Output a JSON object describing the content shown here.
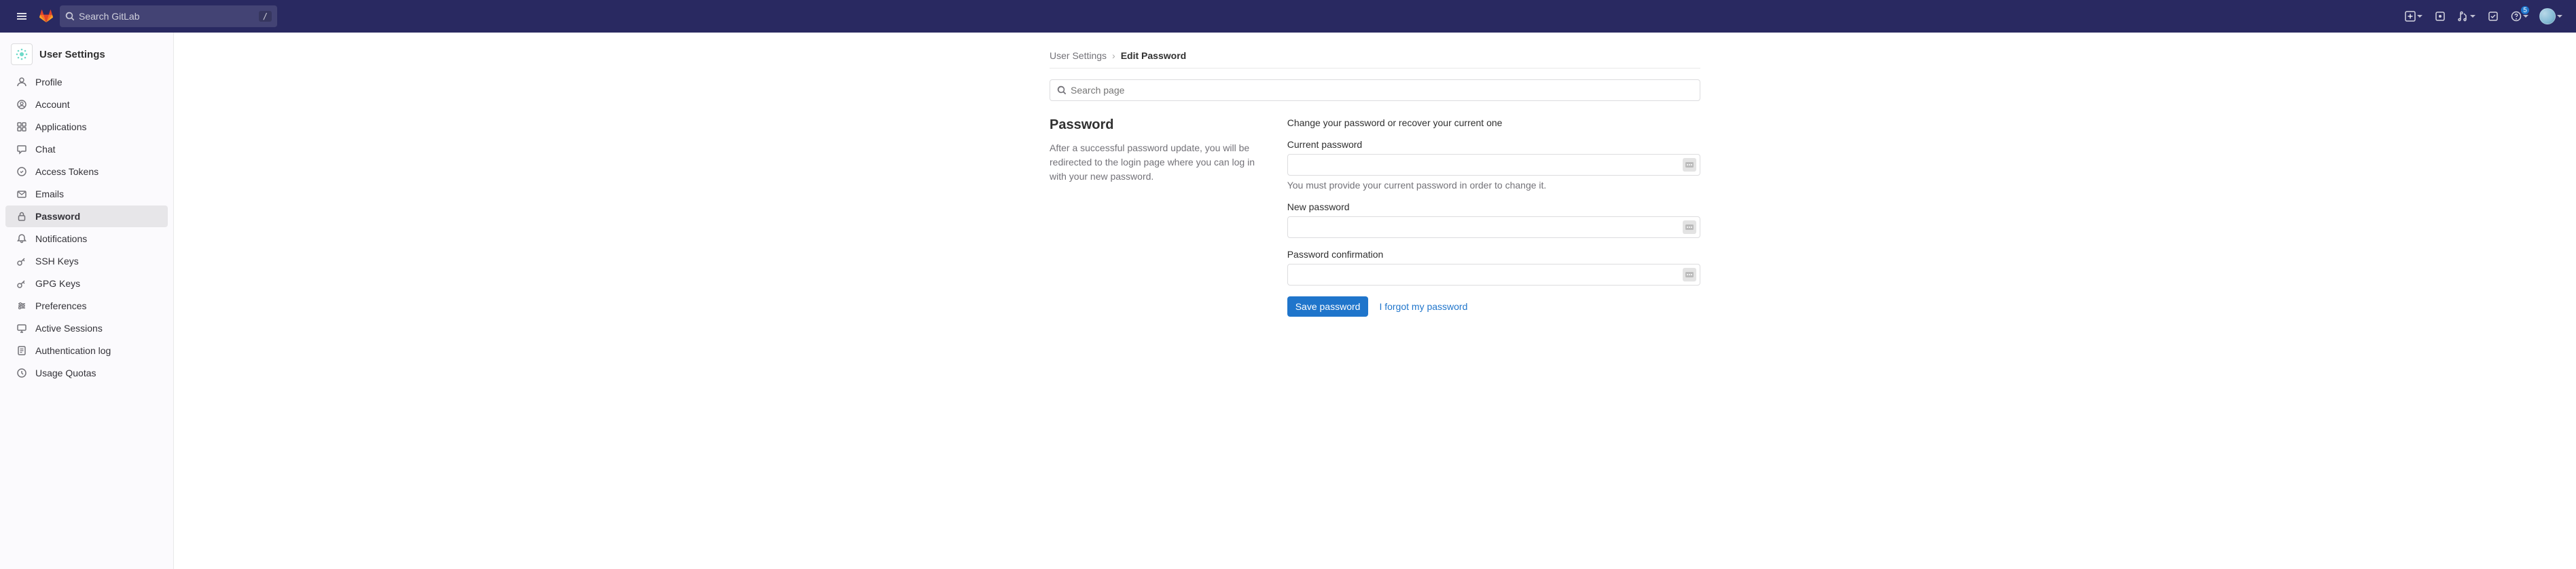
{
  "header": {
    "search_placeholder": "Search GitLab",
    "search_shortcut": "/",
    "issues_count": "5"
  },
  "sidebar": {
    "title": "User Settings",
    "items": [
      {
        "label": "Profile",
        "icon": "profile-icon"
      },
      {
        "label": "Account",
        "icon": "account-icon"
      },
      {
        "label": "Applications",
        "icon": "applications-icon"
      },
      {
        "label": "Chat",
        "icon": "chat-icon"
      },
      {
        "label": "Access Tokens",
        "icon": "token-icon"
      },
      {
        "label": "Emails",
        "icon": "email-icon"
      },
      {
        "label": "Password",
        "icon": "lock-icon",
        "active": true
      },
      {
        "label": "Notifications",
        "icon": "bell-icon"
      },
      {
        "label": "SSH Keys",
        "icon": "key-icon"
      },
      {
        "label": "GPG Keys",
        "icon": "key-icon"
      },
      {
        "label": "Preferences",
        "icon": "preferences-icon"
      },
      {
        "label": "Active Sessions",
        "icon": "sessions-icon"
      },
      {
        "label": "Authentication log",
        "icon": "log-icon"
      },
      {
        "label": "Usage Quotas",
        "icon": "quota-icon"
      }
    ]
  },
  "breadcrumb": {
    "root": "User Settings",
    "current": "Edit Password"
  },
  "page_search": {
    "placeholder": "Search page"
  },
  "section": {
    "title": "Password",
    "desc": "After a successful password update, you will be redirected to the login page where you can log in with your new password.",
    "intro": "Change your password or recover your current one",
    "current_label": "Current password",
    "current_help": "You must provide your current password in order to change it.",
    "new_label": "New password",
    "confirm_label": "Password confirmation",
    "save_label": "Save password",
    "forgot_label": "I forgot my password"
  }
}
